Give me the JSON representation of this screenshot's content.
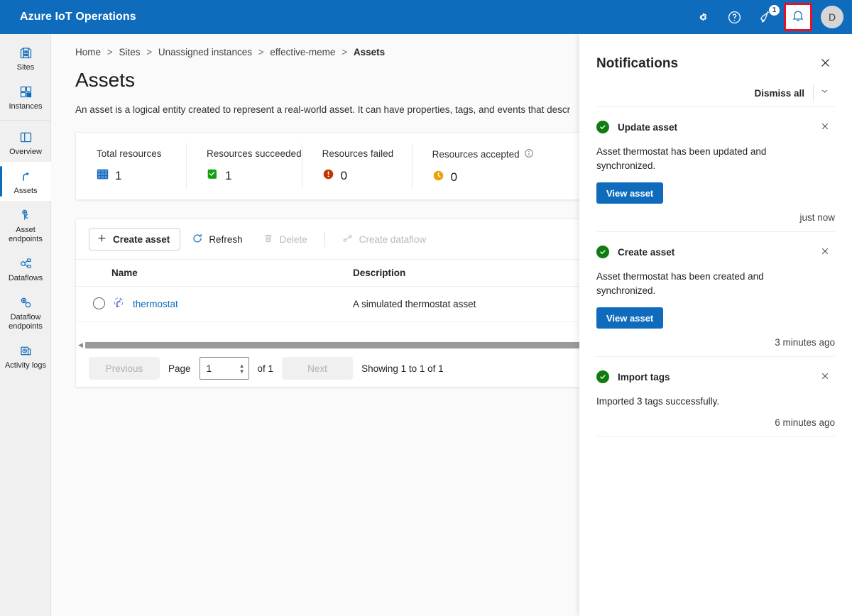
{
  "header": {
    "title": "Azure IoT Operations",
    "settings_label": "Settings",
    "settings_icon": "gear-icon",
    "help_label": "Help",
    "help_icon": "question-circle-icon",
    "feedback_label": "Feedback",
    "feedback_icon": "megaphone-icon",
    "feedback_badge": "1",
    "notifications_label": "Notifications",
    "notifications_icon": "bell-icon",
    "avatar_initial": "D",
    "brand_color": "#0f6cbd",
    "highlight_color": "#e81123"
  },
  "sidebar": {
    "groups": [
      {
        "items": [
          {
            "label": "Sites",
            "icon": "sites-icon",
            "active": false
          },
          {
            "label": "Instances",
            "icon": "instances-icon",
            "active": false
          }
        ]
      },
      {
        "items": [
          {
            "label": "Overview",
            "icon": "overview-icon",
            "active": false
          },
          {
            "label": "Assets",
            "icon": "assets-icon",
            "active": true
          },
          {
            "label": "Asset endpoints",
            "icon": "asset-endpoints-icon",
            "active": false
          },
          {
            "label": "Dataflows",
            "icon": "dataflows-icon",
            "active": false
          },
          {
            "label": "Dataflow endpoints",
            "icon": "dataflow-endpoints-icon",
            "active": false
          },
          {
            "label": "Activity logs",
            "icon": "activity-logs-icon",
            "active": false
          }
        ]
      }
    ]
  },
  "breadcrumb": {
    "items": [
      "Home",
      "Sites",
      "Unassigned instances",
      "effective-meme"
    ],
    "current": "Assets",
    "separator": ">"
  },
  "page": {
    "title": "Assets",
    "description": "An asset is a logical entity created to represent a real-world asset. It can have properties, tags, and events that descr"
  },
  "metrics": [
    {
      "label": "Total resources",
      "value": "1",
      "icon": "grid-icon",
      "color": "#2266cc",
      "has_info": false
    },
    {
      "label": "Resources succeeded",
      "value": "1",
      "icon": "success-check-icon",
      "color": "#107c10",
      "has_info": false
    },
    {
      "label": "Resources failed",
      "value": "0",
      "icon": "error-icon",
      "color": "#c43501",
      "has_info": false
    },
    {
      "label": "Resources accepted",
      "value": "0",
      "icon": "pending-clock-icon",
      "color": "#eaa300",
      "has_info": true,
      "info_icon": "info-icon"
    }
  ],
  "toolbar": {
    "create_asset": "Create asset",
    "create_asset_icon": "plus-icon",
    "refresh": "Refresh",
    "refresh_icon": "refresh-icon",
    "delete": "Delete",
    "delete_icon": "trash-icon",
    "create_dataflow": "Create dataflow",
    "create_dataflow_icon": "dataflow-icon"
  },
  "table": {
    "columns": [
      "Name",
      "Description"
    ],
    "rows": [
      {
        "name": "thermostat",
        "description": "A simulated thermostat asset",
        "icon": "thermostat-asset-icon",
        "selected": false
      }
    ]
  },
  "pagination": {
    "previous": "Previous",
    "page_label": "Page",
    "page_value": "1",
    "of_label": "of 1",
    "next": "Next",
    "showing": "Showing 1 to 1 of 1"
  },
  "notifications_panel": {
    "title": "Notifications",
    "close_icon": "close-icon",
    "dismiss_all": "Dismiss all",
    "chevron_icon": "chevron-down-icon",
    "items": [
      {
        "title": "Update asset",
        "status_icon": "success-check-icon",
        "body": "Asset thermostat has been updated and synchronized.",
        "action": "View asset",
        "time": "just now",
        "dismiss_icon": "close-icon"
      },
      {
        "title": "Create asset",
        "status_icon": "success-check-icon",
        "body": "Asset thermostat has been created and synchronized.",
        "action": "View asset",
        "time": "3 minutes ago",
        "dismiss_icon": "close-icon"
      },
      {
        "title": "Import tags",
        "status_icon": "success-check-icon",
        "body": "Imported 3 tags successfully.",
        "action": null,
        "time": "6 minutes ago",
        "dismiss_icon": "close-icon"
      }
    ]
  }
}
